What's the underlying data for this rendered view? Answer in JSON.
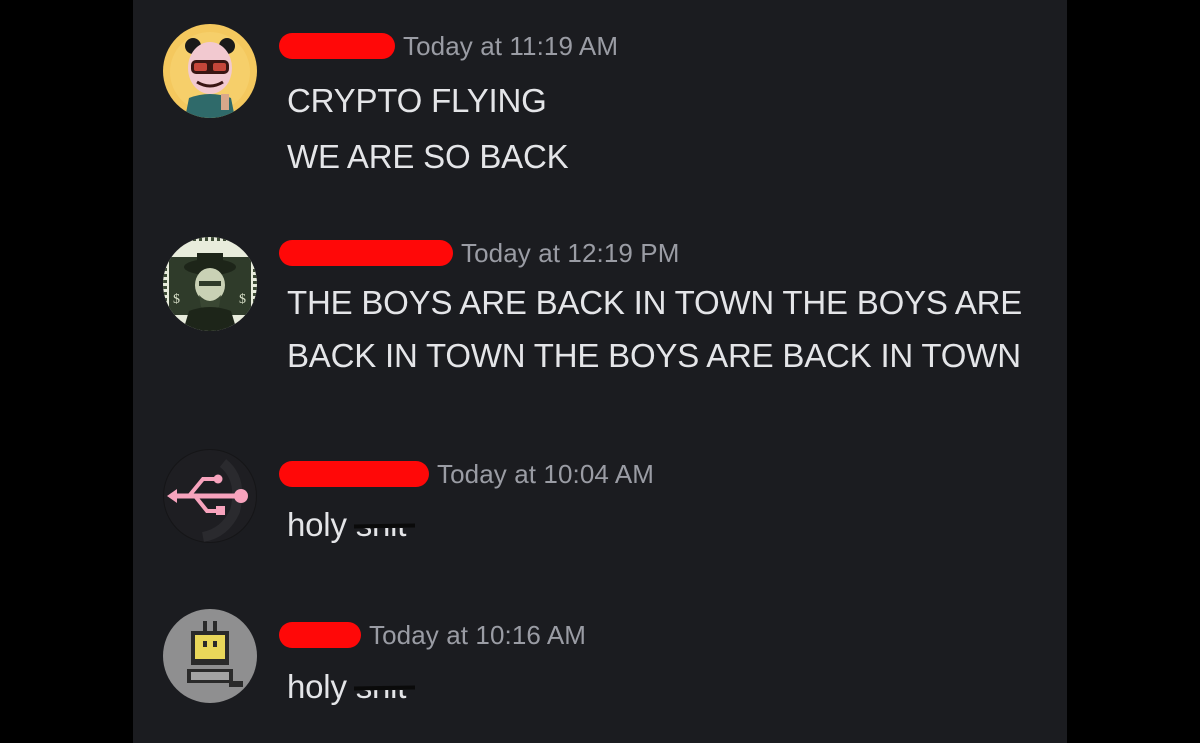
{
  "messages": [
    {
      "timestamp": "Today at 11:19 AM",
      "lines": [
        "CRYPTO FLYING",
        "WE ARE SO BACK"
      ],
      "avatar_icon": "panda-mask-avatar-icon"
    },
    {
      "timestamp": "Today at 12:19 PM",
      "lines": [
        "THE BOYS ARE BACK IN TOWN THE BOYS ARE",
        "BACK IN TOWN THE BOYS ARE BACK IN TOWN"
      ],
      "avatar_icon": "banknote-portrait-avatar-icon"
    },
    {
      "timestamp": "Today at 10:04 AM",
      "text_visible": "holy",
      "text_censored": "shit",
      "avatar_icon": "usb-symbol-avatar-icon"
    },
    {
      "timestamp": "Today at 10:16 AM",
      "text_visible": "holy",
      "text_censored": "shit",
      "avatar_icon": "pixel-computer-avatar-icon"
    }
  ],
  "colors": {
    "background": "#1b1c20",
    "redaction": "#ff0808",
    "timestamp": "#9a9ca4",
    "message_text": "#e4e5e8"
  }
}
